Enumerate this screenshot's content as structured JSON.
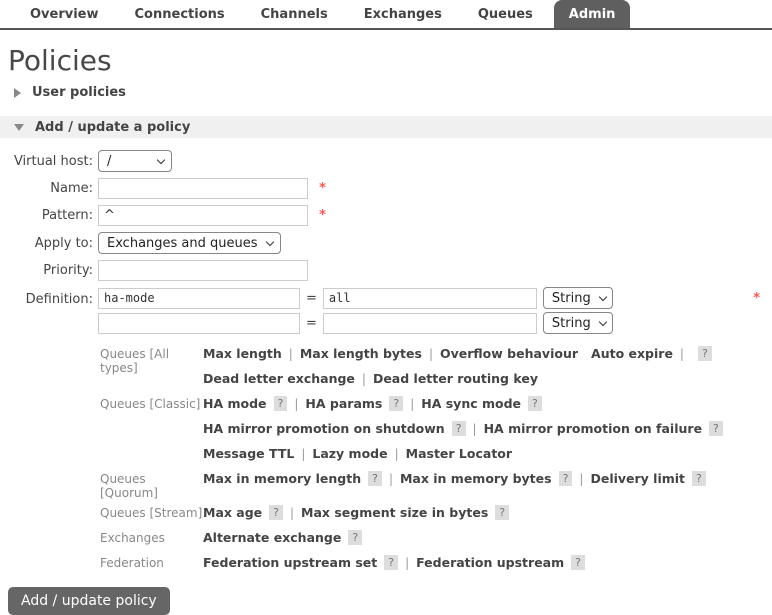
{
  "tabs": [
    {
      "label": "Overview",
      "active": false
    },
    {
      "label": "Connections",
      "active": false
    },
    {
      "label": "Channels",
      "active": false
    },
    {
      "label": "Exchanges",
      "active": false
    },
    {
      "label": "Queues",
      "active": false
    },
    {
      "label": "Admin",
      "active": true
    }
  ],
  "page": {
    "title": "Policies"
  },
  "sections": {
    "user_policies": {
      "label": "User policies",
      "collapsed": true
    },
    "add_update": {
      "label": "Add / update a policy",
      "collapsed": false
    }
  },
  "form": {
    "virtual_host": {
      "label": "Virtual host:",
      "value": "/"
    },
    "name": {
      "label": "Name:",
      "value": "",
      "required": "*"
    },
    "pattern": {
      "label": "Pattern:",
      "value": "^",
      "required": "*"
    },
    "apply_to": {
      "label": "Apply to:",
      "value": "Exchanges and queues"
    },
    "priority": {
      "label": "Priority:",
      "value": ""
    },
    "definition": {
      "label": "Definition:",
      "required": "*",
      "rows": [
        {
          "key": "ha-mode",
          "eq": "=",
          "value": "all",
          "type": "String"
        },
        {
          "key": "",
          "eq": "=",
          "value": "",
          "type": "String"
        }
      ]
    }
  },
  "help": {
    "badge": "?",
    "separator": "|",
    "groups": [
      {
        "category": "Queues [All types]",
        "lines": [
          [
            {
              "link": "Max length"
            },
            {
              "pipe": true
            },
            {
              "link": "Max length bytes"
            },
            {
              "pipe": true
            },
            {
              "link": "Overflow behaviour"
            },
            {
              "gap": true
            },
            {
              "link": "Auto expire"
            },
            {
              "pipe": true
            },
            {
              "badge": true
            }
          ],
          [
            {
              "link": "Dead letter exchange"
            },
            {
              "pipe": true
            },
            {
              "link": "Dead letter routing key"
            }
          ]
        ]
      },
      {
        "category": "Queues [Classic]",
        "lines": [
          [
            {
              "link": "HA mode"
            },
            {
              "badge": true
            },
            {
              "pipe": true
            },
            {
              "link": "HA params"
            },
            {
              "badge": true
            },
            {
              "pipe": true
            },
            {
              "link": "HA sync mode"
            },
            {
              "badge": true
            }
          ],
          [
            {
              "link": "HA mirror promotion on shutdown"
            },
            {
              "badge": true
            },
            {
              "pipe": true
            },
            {
              "link": "HA mirror promotion on failure"
            },
            {
              "badge": true
            }
          ],
          [
            {
              "link": "Message TTL"
            },
            {
              "pipe": true
            },
            {
              "link": "Lazy mode"
            },
            {
              "pipe": true
            },
            {
              "link": "Master Locator"
            }
          ]
        ]
      },
      {
        "category": "Queues [Quorum]",
        "lines": [
          [
            {
              "link": "Max in memory length"
            },
            {
              "badge": true
            },
            {
              "pipe": true
            },
            {
              "link": "Max in memory bytes"
            },
            {
              "badge": true
            },
            {
              "pipe": true
            },
            {
              "link": "Delivery limit"
            },
            {
              "badge": true
            }
          ]
        ]
      },
      {
        "category": "Queues [Stream]",
        "lines": [
          [
            {
              "link": "Max age"
            },
            {
              "badge": true
            },
            {
              "pipe": true
            },
            {
              "link": "Max segment size in bytes"
            },
            {
              "badge": true
            }
          ]
        ]
      },
      {
        "category": "Exchanges",
        "lines": [
          [
            {
              "link": "Alternate exchange"
            },
            {
              "badge": true
            }
          ]
        ]
      },
      {
        "category": "Federation",
        "lines": [
          [
            {
              "link": "Federation upstream set"
            },
            {
              "badge": true
            },
            {
              "pipe": true
            },
            {
              "link": "Federation upstream"
            },
            {
              "badge": true
            }
          ]
        ]
      }
    ]
  },
  "submit": {
    "label": "Add / update policy"
  },
  "colors": {
    "tab_active_bg": "#5f5f5f",
    "tab_underline": "#555555",
    "section_bg": "#f0f0f0",
    "required": "#ff5555",
    "help_badge_bg": "#dddddd",
    "link_text": "#444444",
    "muted_text": "#888888",
    "button_bg": "#666666"
  }
}
